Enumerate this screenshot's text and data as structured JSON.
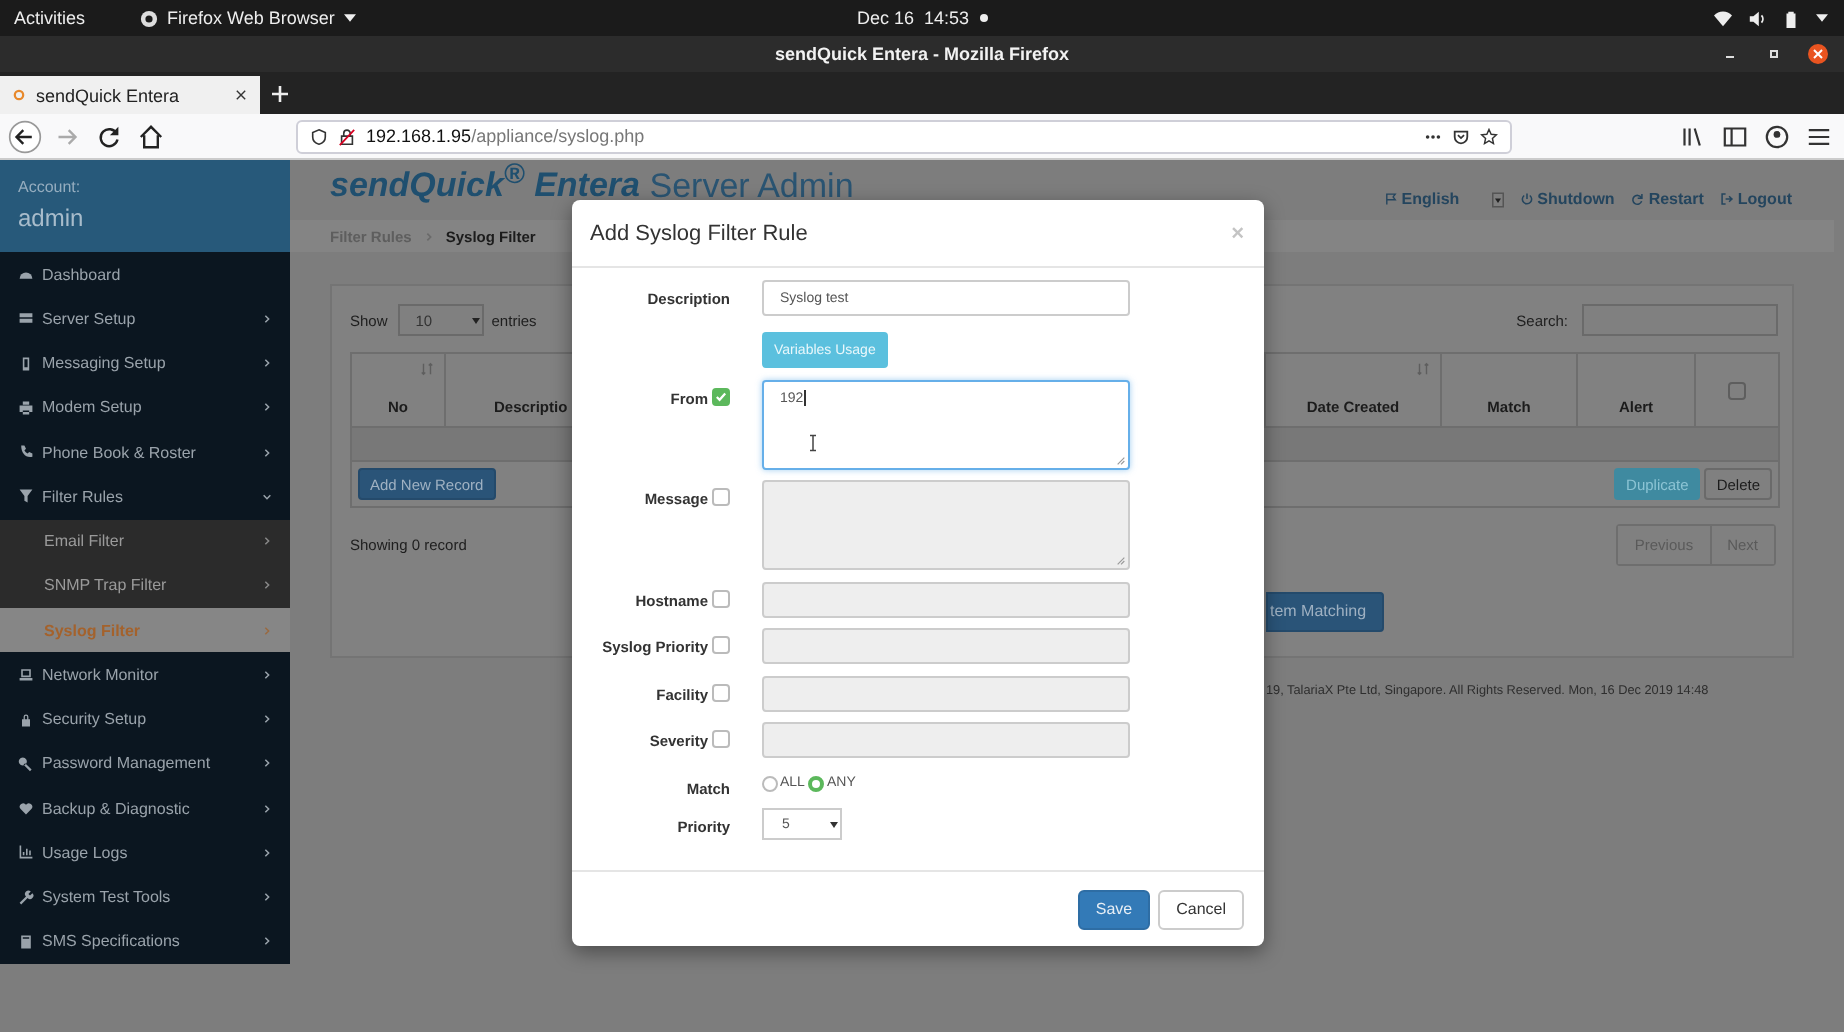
{
  "topbar": {
    "activities": "Activities",
    "app": "Firefox Web Browser",
    "date": "Dec 16",
    "time": "14:53"
  },
  "browser": {
    "title": "sendQuick Entera - Mozilla Firefox",
    "tab": "sendQuick Entera",
    "url_host": "192.168.1.95",
    "url_path": "/appliance/syslog.php"
  },
  "sidebar": {
    "account_label": "Account:",
    "account": "admin",
    "items": [
      {
        "label": "Dashboard",
        "kind": "link",
        "selected": false
      },
      {
        "label": "Server Setup",
        "kind": "menu",
        "expanded": false,
        "selected": false
      },
      {
        "label": "Messaging Setup",
        "kind": "menu",
        "expanded": false,
        "selected": false
      },
      {
        "label": "Modem Setup",
        "kind": "menu",
        "expanded": false,
        "selected": false
      },
      {
        "label": "Phone Book & Roster",
        "kind": "menu",
        "expanded": false,
        "selected": false
      },
      {
        "label": "Filter Rules",
        "kind": "menu",
        "expanded": true,
        "selected": false,
        "children": [
          {
            "label": "Email Filter",
            "selected": false
          },
          {
            "label": "SNMP Trap Filter",
            "selected": false
          },
          {
            "label": "Syslog Filter",
            "selected": true
          }
        ]
      },
      {
        "label": "Network Monitor",
        "kind": "menu",
        "expanded": false,
        "selected": false
      },
      {
        "label": "Security Setup",
        "kind": "menu",
        "expanded": false,
        "selected": false
      },
      {
        "label": "Password Management",
        "kind": "menu",
        "expanded": false,
        "selected": false
      },
      {
        "label": "Backup & Diagnostic",
        "kind": "menu",
        "expanded": false,
        "selected": false
      },
      {
        "label": "Usage Logs",
        "kind": "menu",
        "expanded": false,
        "selected": false
      },
      {
        "label": "System Test Tools",
        "kind": "menu",
        "expanded": false,
        "selected": false
      },
      {
        "label": "SMS Specifications",
        "kind": "menu",
        "expanded": false,
        "selected": false
      }
    ]
  },
  "header": {
    "logo": "sendQuick$^{®}$ Entera",
    "tagline": "Server Admin",
    "links": [
      "English",
      "Shutdown",
      "Restart",
      "Logout"
    ]
  },
  "breadcrumb": [
    "Filter Rules",
    "Syslog Filter"
  ],
  "panel": {
    "show_label": "Show",
    "page_size": "10",
    "entries_label": "entries",
    "search_label": "Search:",
    "columns": [
      {
        "label": "No"
      },
      {
        "label": "Descriptio"
      },
      {
        "label": "Date Created"
      },
      {
        "label": "Match"
      },
      {
        "label": "Alert"
      }
    ],
    "select_all_checked": false,
    "add_button": "Add New Record",
    "row_buttons": [
      {
        "label": "Duplicate",
        "kind": "info"
      },
      {
        "label": "Delete",
        "kind": "default"
      }
    ],
    "info": "Showing 0 record",
    "pagination": [
      "Previous",
      "Next"
    ],
    "pattern_button": "tem Matching"
  },
  "footer": "19, TalariaX Pte Ltd, Singapore. All Rights Reserved. Mon, 16 Dec 2019 14:48",
  "modal": {
    "title": "Add Syslog Filter Rule",
    "close": "×",
    "fields": [
      {
        "kind": "text",
        "label": "Description",
        "value": "Syslog test"
      },
      {
        "kind": "button",
        "label": "Variables Usage"
      },
      {
        "kind": "textarea",
        "label": "From",
        "checked": true,
        "value": "192",
        "focused": true
      },
      {
        "kind": "textarea",
        "label": "Message",
        "checked": false
      },
      {
        "kind": "text",
        "label": "Hostname",
        "checked": false
      },
      {
        "kind": "text",
        "label": "Syslog Priority",
        "checked": false
      },
      {
        "kind": "text",
        "label": "Facility",
        "checked": false
      },
      {
        "kind": "text",
        "label": "Severity",
        "checked": false
      },
      {
        "kind": "radio",
        "label": "Match",
        "options": [
          {
            "label": "ALL",
            "selected": false
          },
          {
            "label": "ANY",
            "selected": true
          }
        ]
      },
      {
        "kind": "select",
        "label": "Priority",
        "value": "5"
      }
    ],
    "buttons": [
      {
        "label": "Save",
        "kind": "primary"
      },
      {
        "label": "Cancel",
        "kind": "default"
      }
    ]
  }
}
